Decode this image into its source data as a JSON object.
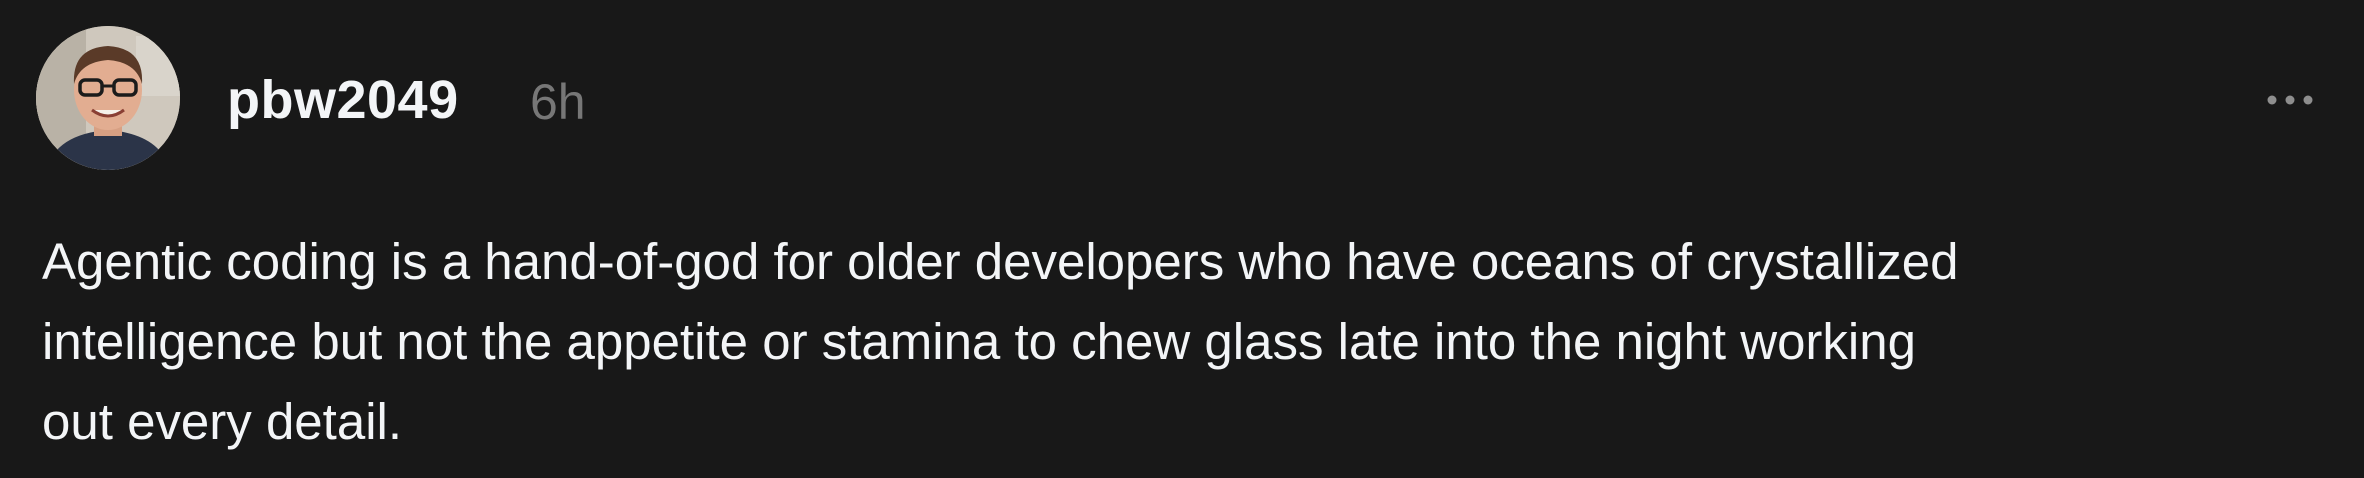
{
  "post": {
    "username": "pbw2049",
    "timestamp": "6h",
    "body": "Agentic coding is a hand-of-god for older developers who have oceans of crystallized\nintelligence but not the appetite or stamina to chew glass late into the night working\nout every detail.",
    "menu_icon": "more-horizontal-icon",
    "avatar": "profile-photo"
  },
  "colors": {
    "background": "#181818",
    "text_primary": "#f3f5f7",
    "text_secondary": "#777777",
    "icon": "#8e8e8e"
  }
}
